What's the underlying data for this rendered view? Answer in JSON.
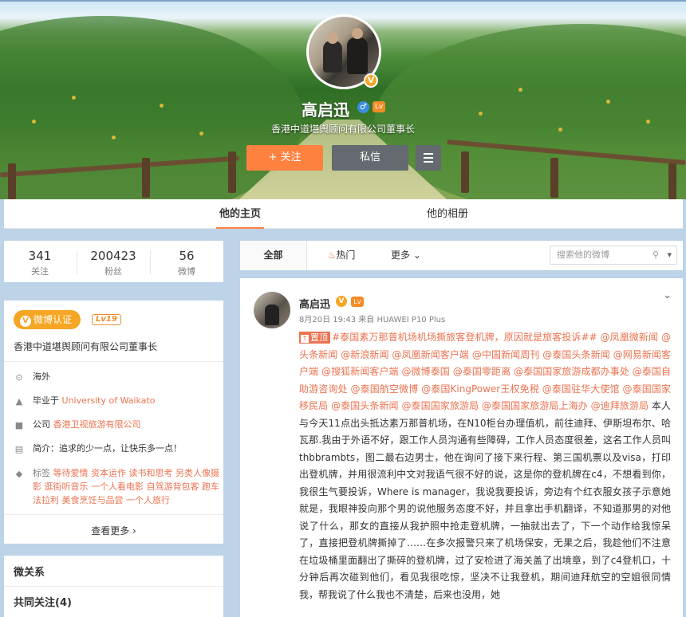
{
  "profile": {
    "name": "高启迅",
    "gender_symbol": "♂",
    "level_icon": "Lv",
    "verified_mark": "V",
    "description": "香港中道堪舆顾问有限公司董事长",
    "follow_label": "+ 关注",
    "message_label": "私信"
  },
  "tabs": {
    "home": "他的主页",
    "album": "他的相册"
  },
  "stats": [
    {
      "value": "341",
      "label": "关注"
    },
    {
      "value": "200423",
      "label": "粉丝"
    },
    {
      "value": "56",
      "label": "微博"
    }
  ],
  "info": {
    "verify_label": "微博认证",
    "verify_icon": "V",
    "level": "Lv19",
    "verify_text": "香港中道堪舆顾问有限公司董事长",
    "location": "海外",
    "school_prefix": "毕业于",
    "school": "University of Waikato",
    "company_prefix": "公司",
    "company": "香港卫视旅游有限公司",
    "bio_prefix": "简介：",
    "bio": "追求的少一点，让快乐多一点！",
    "tags_prefix": "标签",
    "tags": "等待爱情 资本运作 读书和思考 另类人像摄影 逛街听音乐 一个人看电影 自驾游背包客 跑车法拉利 美食烹饪与品尝 一个人旅行",
    "see_more": "查看更多 ›"
  },
  "relation": {
    "title": "微关系",
    "common_follow": "共同关注(4)"
  },
  "filter": {
    "all": "全部",
    "hot": "热门",
    "more": "更多",
    "search_placeholder": "搜索他的微博"
  },
  "post": {
    "name": "高启迅",
    "verified_mark": "V",
    "level_icon": "Lv",
    "meta": "8月20日 19:43 来自 HUAWEI P10 Plus",
    "pin_label": "置顶",
    "tags_text": "#泰国素万那普机场机场撕旅客登机牌，原因就是旅客投诉## @凤凰微新闻 @头条新闻 @新浪新闻 @凤凰新闻客户端 @中国新闻周刊 @泰国头条新闻 @网易新闻客户端 @搜狐新闻客户端 @微博泰国 @泰国零距离 @泰国国家旅游成都办事处 @泰国自助游咨询处 @泰国航空微博 @泰国KingPower王权免税 @泰国驻华大使馆 @泰国国家移民局 @泰国头条新闻 @泰国国家旅游局 @泰国国家旅游局上海办 @迪拜旅游局",
    "body_text": " 本人与今天11点出头抵达素万那普机场，在N10柜台办理值机，前往迪拜、伊斯坦布尔、哈瓦那.我由于外语不好，跟工作人员沟通有些障碍，工作人员态度很差，这名工作人员叫thbbrambts，图二最右边男士，他在询问了接下来行程、第三国机票以及visa，打印出登机牌，并用很流利中文对我语气很不好的说，这是你的登机牌在c4，不想看到你，我很生气要投诉，Where is manager，我说我要投诉，旁边有个红衣服女孩子示意她就是，我眼神投向那个男的说他服务态度不好，并且拿出手机翻译，不知道那男的对他说了什么，那女的直接从我护照中抢走登机牌，一抽就出去了，下一个动作给我惊呆了，直接把登机牌撕掉了……在多次报警只来了机场保安，无果之后，我趁他们不注意在垃圾桶里面翻出了撕碎的登机牌，过了安检进了海关盖了出境章，到了c4登机口，十分钟后再次碰到他们，看见我很吃惊，坚决不让我登机，期间迪拜航空的空姐很同情我，帮我说了什么我也不清楚，后来也没用，她"
  }
}
